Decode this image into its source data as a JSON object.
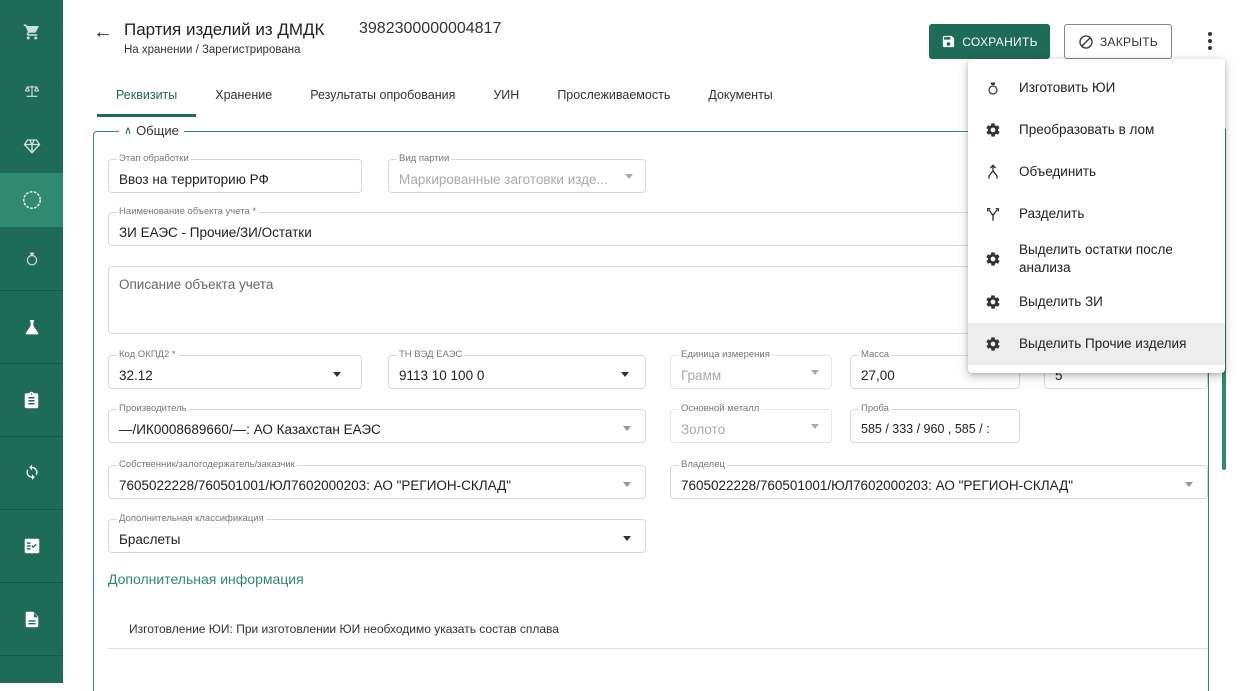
{
  "sidebar": {
    "items": [
      {
        "icon": "cart-icon"
      },
      {
        "icon": "scales-icon"
      },
      {
        "icon": "diamond-icon"
      },
      {
        "icon": "ring-icon"
      },
      {
        "icon": "ring-outline-icon"
      },
      {
        "icon": "flask-icon"
      },
      {
        "icon": "clipboard-icon"
      },
      {
        "icon": "sync-icon"
      },
      {
        "icon": "checklist-icon"
      },
      {
        "icon": "document-icon"
      }
    ]
  },
  "header": {
    "title": "Партия изделий из ДМДК",
    "subtitle": "На хранении / Зарегистрирована",
    "doc_number": "3982300000004817",
    "save_label": "СОХРАНИТЬ",
    "close_label": "ЗАКРЫТЬ"
  },
  "tabs": [
    "Реквизиты",
    "Хранение",
    "Результаты опробования",
    "УИН",
    "Прослеживаемость",
    "Документы"
  ],
  "active_tab": "Реквизиты",
  "section": {
    "title": "Общие"
  },
  "form": {
    "stage": {
      "label": "Этап обработки",
      "value": "Ввоз на территорию РФ"
    },
    "batch_type": {
      "label": "Вид партии",
      "value": "Маркированные заготовки изде..."
    },
    "object_name": {
      "label": "Наименование объекта учета *",
      "value": "ЗИ ЕАЭС - Прочие/ЗИ/Остатки"
    },
    "description": {
      "placeholder": "Описание объекта учета"
    },
    "okpd": {
      "label": "Код ОКПД2 *",
      "value": "32.12"
    },
    "tnved": {
      "label": "ТН ВЭД ЕАЭС",
      "value": "9113 10 100 0"
    },
    "unit": {
      "label": "Единица измерения",
      "value": "Грамм"
    },
    "mass": {
      "label": "Масса",
      "value": "27,00"
    },
    "count": {
      "value": "5"
    },
    "manufacturer": {
      "label": "Производитель",
      "value": "—/ИК0008689660/—: АО Казахстан ЕАЭС"
    },
    "metal": {
      "label": "Основной металл",
      "value": "Золото"
    },
    "fineness": {
      "label": "Проба",
      "value": "585 / 333 / 960 , 585 / :"
    },
    "owner_pledge": {
      "label": "Собственник/залогодержатель/заказчик",
      "value": "7605022228/760501001/ЮЛ7602000203: АО \"РЕГИОН-СКЛАД\""
    },
    "owner": {
      "label": "Владелец",
      "value": "7605022228/760501001/ЮЛ7602000203: АО \"РЕГИОН-СКЛАД\""
    },
    "classification": {
      "label": "Дополнительная классификация",
      "value": "Браслеты"
    }
  },
  "additional_info": {
    "title": "Дополнительная информация",
    "note": "Изготовление ЮИ: При изготовлении ЮИ необходимо указать состав сплава"
  },
  "menu": {
    "items": [
      {
        "label": "Изготовить ЮИ",
        "icon": "ring-outline-icon"
      },
      {
        "label": "Преобразовать в лом",
        "icon": "gear-icon"
      },
      {
        "label": "Объединить",
        "icon": "merge-icon"
      },
      {
        "label": "Разделить",
        "icon": "split-icon"
      },
      {
        "label": "Выделить остатки после анализа",
        "icon": "gear-icon"
      },
      {
        "label": "Выделить ЗИ",
        "icon": "gear-icon"
      },
      {
        "label": "Выделить Прочие изделия",
        "icon": "gear-icon"
      }
    ],
    "highlighted_index": 6
  },
  "colors": {
    "primary": "#1e6b57",
    "accent": "#2f8a70"
  }
}
